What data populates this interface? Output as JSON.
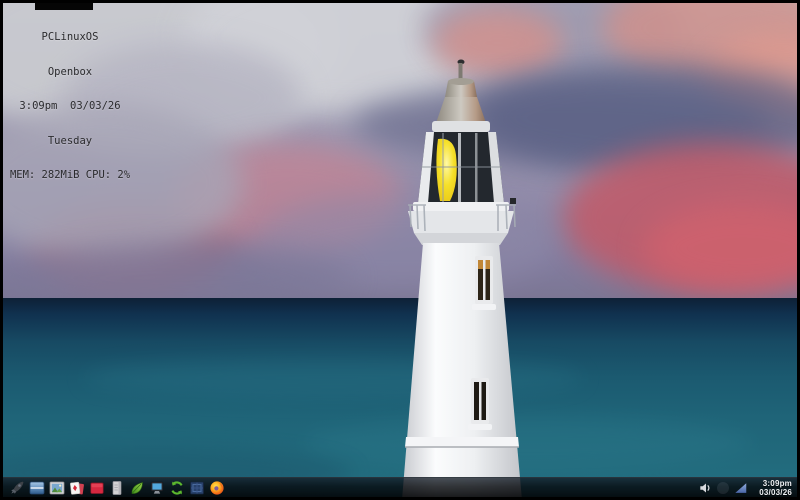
{
  "os": {
    "name": "PCLinuxOS",
    "window_manager": "Openbox"
  },
  "conky": {
    "lines": [
      "PCLinuxOS",
      "Openbox",
      "3:09pm  03/03/26",
      "Tuesday",
      "MEM: 282MiB CPU: 2%"
    ]
  },
  "taskbar": {
    "launcher_icons": [
      "rocket-launcher-icon",
      "file-manager-icon",
      "image-viewer-icon",
      "cards-game-icon",
      "red-app-icon",
      "document-icon",
      "leafpad-icon",
      "display-settings-icon",
      "sync-update-icon",
      "package-box-icon",
      "firefox-icon"
    ],
    "tray": {
      "volume_icon": "volume-icon",
      "network_icon": "network-signal-icon",
      "clock_time": "3:09pm",
      "clock_date": "03/03/26"
    }
  },
  "wallpaper": {
    "subject": "lighthouse at dusk over the sea"
  },
  "colors": {
    "sky_purple": "#8d87a6",
    "cloud_pink": "#c25a68",
    "sea_teal": "#1f6478",
    "lighthouse_white": "#f2f3f4",
    "lantern_yellow": "#f2de20",
    "taskbar_bg": "rgba(6,9,13,0.82)",
    "clock_text": "#eef1f4"
  }
}
